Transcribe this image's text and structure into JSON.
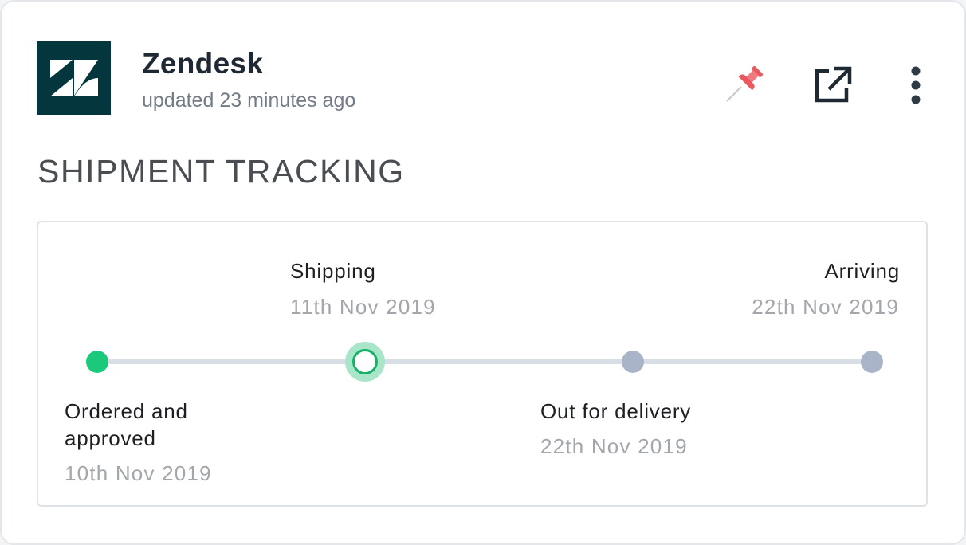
{
  "header": {
    "logo_icon": "zendesk-logo",
    "app_name": "Zendesk",
    "updated": "updated 23 minutes ago",
    "actions": [
      {
        "icon": "pin-icon",
        "color": "#e8585d"
      },
      {
        "icon": "external-link-icon",
        "color": "#1f2933"
      },
      {
        "icon": "more-vertical-icon",
        "color": "#2e3a46"
      }
    ]
  },
  "section_title": "SHIPMENT TRACKING",
  "tracking": {
    "steps": [
      {
        "label": "Ordered and approved",
        "date": "10th Nov 2019",
        "status": "completed"
      },
      {
        "label": "Shipping",
        "date": "11th Nov 2019",
        "status": "current"
      },
      {
        "label": "Out for delivery",
        "date": "22th Nov 2019",
        "status": "pending"
      },
      {
        "label": "Arriving",
        "date": "22th Nov 2019",
        "status": "pending"
      }
    ],
    "colors": {
      "completed": "#1cc97a",
      "current": "#17b26a",
      "pending": "#a9b4c9",
      "track": "#d8dee5"
    }
  }
}
